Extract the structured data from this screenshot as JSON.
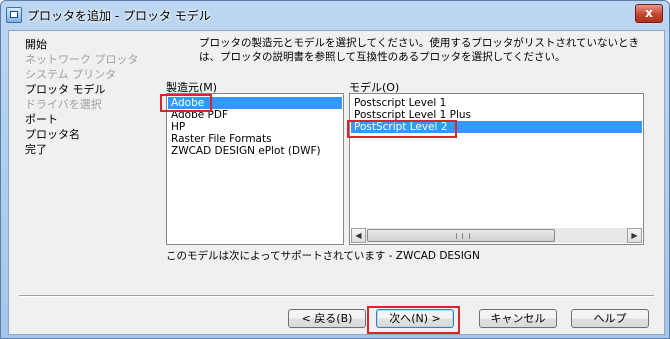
{
  "window": {
    "title": "プロッタを追加 - プロッタ モデル",
    "close_glyph": "x"
  },
  "steps": [
    {
      "label": "開始",
      "enabled": true
    },
    {
      "label": "ネットワーク プロッタ",
      "enabled": false
    },
    {
      "label": "システム プリンタ",
      "enabled": false
    },
    {
      "label": "プロッタ モデル",
      "enabled": true
    },
    {
      "label": "ドライバを選択",
      "enabled": false
    },
    {
      "label": "ポート",
      "enabled": true
    },
    {
      "label": "プロッタ名",
      "enabled": true
    },
    {
      "label": "完了",
      "enabled": true
    }
  ],
  "instructions": "プロッタの製造元とモデルを選択してください。使用するプロッタがリストされていないときは、プロッタの説明書を参照して互換性のあるプロッタを選択してください。",
  "manufacturer": {
    "label": "製造元(M)",
    "items": [
      "Adobe",
      "Adobe PDF",
      "HP",
      "Raster File Formats",
      "ZWCAD DESIGN ePlot (DWF)"
    ],
    "selected_index": 0
  },
  "model": {
    "label": "モデル(O)",
    "items": [
      "Postscript Level 1",
      "Postscript Level 1 Plus",
      "PostScript Level 2"
    ],
    "selected_index": 2
  },
  "support_text": "このモデルは次によってサポートされています - ZWCAD DESIGN",
  "buttons": {
    "back": "< 戻る(B)",
    "next": "次へ(N) >",
    "cancel": "キャンセル",
    "help": "ヘルプ"
  },
  "colors": {
    "selection": "#3399ff",
    "highlight": "#d8262e"
  }
}
